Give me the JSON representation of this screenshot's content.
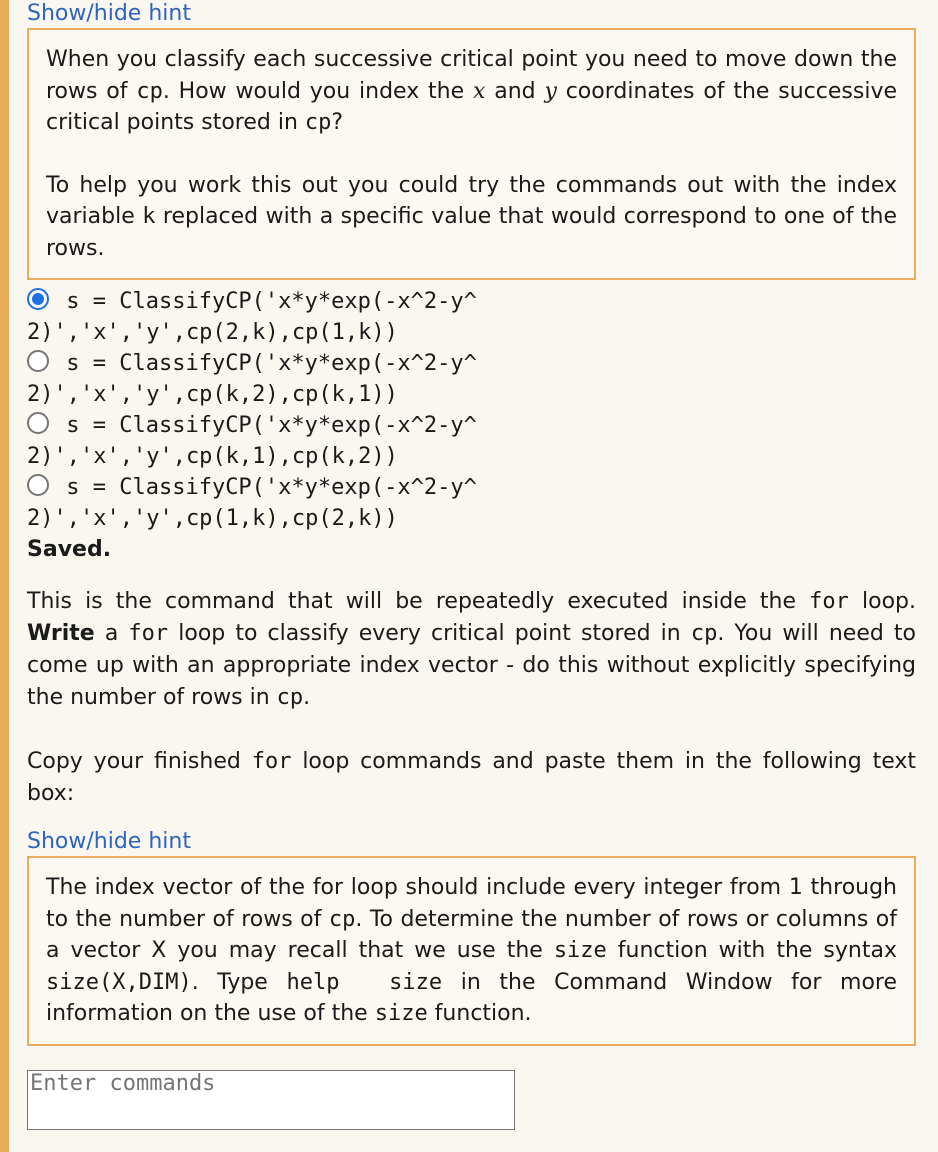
{
  "hint1": {
    "toggle_label": "Show/hide hint",
    "p1_a": "When you classify each successive critical point you need to move down the rows of ",
    "p1_code1": "cp",
    "p1_b": ". How would you index the ",
    "p1_x": "x",
    "p1_c": " and ",
    "p1_y": "y",
    "p1_d": " coordinates of the successive critical points stored in ",
    "p1_code2": "cp",
    "p1_e": "?",
    "p2_a": "To help you work this out you could try the commands out with the index variable ",
    "p2_code": "k",
    "p2_b": " replaced with a specific value that would correspond to one of the rows."
  },
  "options": [
    {
      "text": "s = ClassifyCP('x*y*exp(-x^2-y^2)','x','y',cp(2,k),cp(1,k))",
      "checked": true
    },
    {
      "text": "s = ClassifyCP('x*y*exp(-x^2-y^2)','x','y',cp(k,2),cp(k,1))",
      "checked": false
    },
    {
      "text": "s = ClassifyCP('x*y*exp(-x^2-y^2)','x','y',cp(k,1),cp(k,2))",
      "checked": false
    },
    {
      "text": "s = ClassifyCP('x*y*exp(-x^2-y^2)','x','y',cp(1,k),cp(2,k))",
      "checked": false
    }
  ],
  "status": "Saved.",
  "instructions": {
    "p1_a": "This is the command that will be repeatedly executed inside the ",
    "p1_for1": "for",
    "p1_b": " loop. ",
    "p1_bold": "Write",
    "p1_c": " a ",
    "p1_for2": "for",
    "p1_d": " loop to classify every critical point stored in ",
    "p1_cp1": "cp",
    "p1_e": ". You will need to come up with an appropriate index vector - do this without explicitly specifying the number of rows in ",
    "p1_cp2": "cp",
    "p1_f": ".",
    "p2_a": "Copy your finished ",
    "p2_for": "for",
    "p2_b": " loop commands and paste them in the following text box:"
  },
  "hint2": {
    "toggle_label": "Show/hide hint",
    "a": "The index vector of the for loop should include every integer from 1 through to the number of rows of ",
    "cp": "cp",
    "b": ". To determine the number of rows or columns of a vector X you may recall that we use the ",
    "size1": "size",
    "c": " function with the syntax ",
    "syntax": "size(X,DIM)",
    "d": ". Type ",
    "help": "help  size",
    "e": " in the Command Window for more information on the use of the ",
    "size2": "size",
    "f": " function."
  },
  "answer_box": {
    "placeholder": "Enter commands",
    "value": ""
  }
}
